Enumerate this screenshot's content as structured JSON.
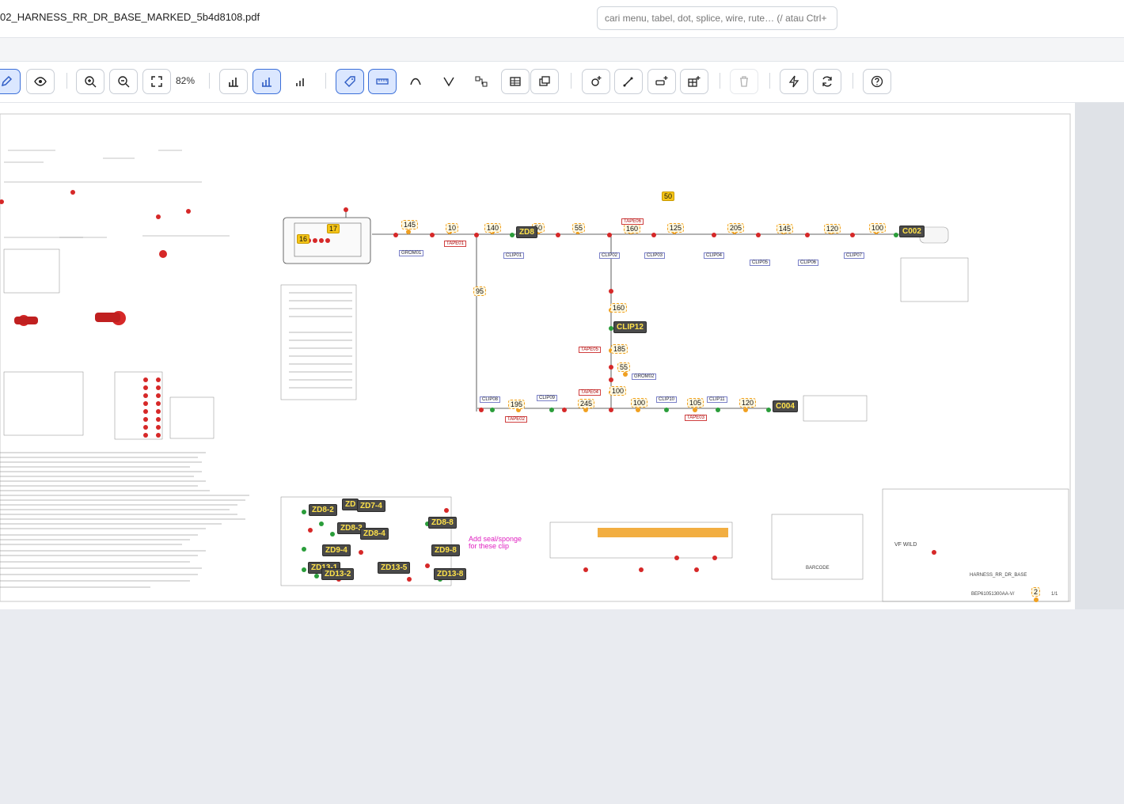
{
  "header": {
    "file_name": "02_HARNESS_RR_DR_BASE_MARKED_5b4d8108.pdf",
    "search_placeholder": "cari menu, tabel, dot, splice, wire, rute… (/ atau Ctrl+"
  },
  "toolbar": {
    "zoom_level": "82%",
    "buttons": [
      {
        "icon": "pencil-icon",
        "active": true
      },
      {
        "icon": "eye-icon",
        "active": false
      },
      {
        "icon": "zoom-in-icon",
        "active": false
      },
      {
        "icon": "zoom-out-icon",
        "active": false
      },
      {
        "icon": "fit-screen-icon",
        "active": false
      },
      {
        "icon": "bar-chart-icon",
        "active": false
      },
      {
        "icon": "bar-chart-icon",
        "active": true
      },
      {
        "icon": "bar-chart-small-icon",
        "active": false
      },
      {
        "icon": "tag-icon",
        "active": true
      },
      {
        "icon": "ruler-icon",
        "active": true
      },
      {
        "icon": "curve-icon",
        "active": false
      },
      {
        "icon": "v-route-icon",
        "active": false
      },
      {
        "icon": "connect-nodes-icon",
        "active": false
      },
      {
        "icon": "table-icon",
        "active": false
      },
      {
        "icon": "layers-icon",
        "active": false
      },
      {
        "icon": "add-dot-icon",
        "active": false
      },
      {
        "icon": "add-wire-icon",
        "active": false
      },
      {
        "icon": "add-splice-icon",
        "active": false
      },
      {
        "icon": "add-table-icon",
        "active": false
      },
      {
        "icon": "delete-icon",
        "active": false,
        "disabled": true
      },
      {
        "icon": "lightning-icon",
        "active": false
      },
      {
        "icon": "refresh-icon",
        "active": false
      },
      {
        "icon": "help-icon",
        "active": false
      }
    ]
  },
  "drawing": {
    "connectors": [
      "C002",
      "C004",
      "CLIP12"
    ],
    "dimension_labels": [
      "145",
      "10",
      "140",
      "50",
      "55",
      "160",
      "125",
      "205",
      "145",
      "120",
      "100",
      "50",
      "95",
      "160",
      "185",
      "55",
      "100",
      "195",
      "245",
      "100",
      "105",
      "120",
      "16",
      "17",
      "2"
    ],
    "zd_labels": [
      "ZD8",
      "ZD",
      "ZD7-4",
      "ZD8-2",
      "ZD8-3",
      "ZD8-4",
      "ZD8-8",
      "ZD9-4",
      "ZD9-8",
      "ZD13-1",
      "ZD13-2",
      "ZD13-5",
      "ZD13-8"
    ],
    "clip_labels": [
      "CLIP01",
      "CLIP02",
      "CLIP03",
      "CLIP04",
      "CLIP05",
      "CLIP06",
      "CLIP07",
      "CLIP08",
      "CLIP09",
      "CLIP10",
      "CLIP11"
    ],
    "tape_labels": [
      "TAPE01",
      "TAPE02",
      "TAPE03",
      "TAPE04",
      "TAPE05",
      "TAPE06"
    ],
    "grommet_labels": [
      "GROM01",
      "GROM02"
    ],
    "note_text": "Add seal/sponge for these clip",
    "title_block": "HARNESS_RR_DR_BASE",
    "part_no": "BEP61051300AA-V/",
    "vf_wild": "VF WILD",
    "barcode_label": "BARCODE",
    "sheet": "1/1"
  },
  "colors": {
    "accent": "#3b6fd8",
    "marker_red": "#d62828",
    "marker_green": "#2a9d3a",
    "marker_orange": "#f0a020",
    "tag_bg": "#4a4a4a",
    "tag_text": "#ffe24a"
  }
}
